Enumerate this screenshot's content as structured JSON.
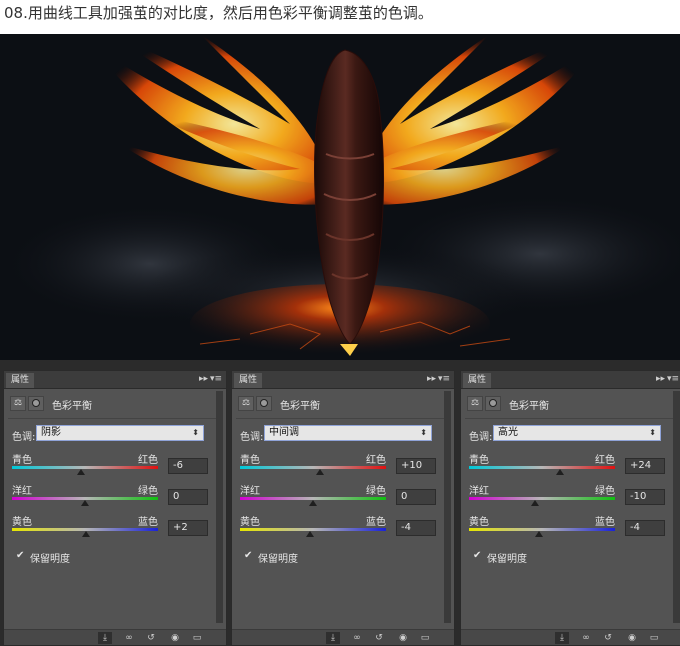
{
  "caption": "08.用曲线工具加强茧的对比度，然后用色彩平衡调整茧的色调。",
  "panels": [
    {
      "tab": "属性",
      "title": "色彩平衡",
      "tone_label": "色调:",
      "tone_value": "阴影",
      "sliders": [
        {
          "left": "青色",
          "right": "红色",
          "value": "-6",
          "num": -6
        },
        {
          "left": "洋红",
          "right": "绿色",
          "value": "0",
          "num": 0
        },
        {
          "left": "黄色",
          "right": "蓝色",
          "value": "+2",
          "num": 2
        }
      ],
      "preserve_label": "保留明度",
      "preserve_checked": true
    },
    {
      "tab": "属性",
      "title": "色彩平衡",
      "tone_label": "色调:",
      "tone_value": "中间调",
      "sliders": [
        {
          "left": "青色",
          "right": "红色",
          "value": "+10",
          "num": 10
        },
        {
          "left": "洋红",
          "right": "绿色",
          "value": "0",
          "num": 0
        },
        {
          "left": "黄色",
          "right": "蓝色",
          "value": "-4",
          "num": -4
        }
      ],
      "preserve_label": "保留明度",
      "preserve_checked": true
    },
    {
      "tab": "属性",
      "title": "色彩平衡",
      "tone_label": "色调:",
      "tone_value": "高光",
      "sliders": [
        {
          "left": "青色",
          "right": "红色",
          "value": "+24",
          "num": 24
        },
        {
          "left": "洋红",
          "right": "绿色",
          "value": "-10",
          "num": -10
        },
        {
          "left": "黄色",
          "right": "蓝色",
          "value": "-4",
          "num": -4
        }
      ],
      "preserve_label": "保留明度",
      "preserve_checked": true
    }
  ],
  "icons": {
    "collapse": "double-chevron-right-icon",
    "menu": "panel-menu-icon",
    "clip": "clip-to-layer-icon",
    "view_previous": "view-previous-state-icon",
    "reset": "reset-icon",
    "visibility": "eye-icon",
    "delete": "trash-icon"
  },
  "colors": {
    "panel_bg": "#535353",
    "artwork_bg": "#0c0f14",
    "fire_orange": "#ff7a10",
    "fire_yellow": "#ffd23c"
  }
}
